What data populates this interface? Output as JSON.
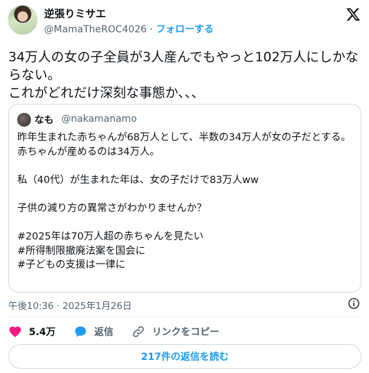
{
  "author": {
    "name": "逆張りミサエ",
    "handle": "@MamaTheROC4026",
    "separator": "·",
    "follow_label": "フォローする"
  },
  "tweet": {
    "text": "34万人の女の子全員が3人産んでもやっと102万人にしかならない。\nこれがどれだけ深刻な事態か、、、"
  },
  "quote": {
    "name": "なも",
    "handle": "@nakamanamo",
    "text": "昨年生まれた赤ちゃんが68万人として、半数の34万人が女の子だとする。\n赤ちゃんが産めるのは34万人。\n\n私（40代）が生まれた年は、女の子だけで83万人ww\n\n子供の減り方の異常さがわかりませんか？\n\n#2025年は70万人超の赤ちゃんを見たい\n#所得制限撤廃法案を国会に\n#子どもの支援は一律に"
  },
  "timestamp": "午後10:36 · 2025年1月26日",
  "actions": {
    "like_count": "5.4万",
    "reply_label": "返信",
    "copy_link_label": "リンクをコピー"
  },
  "read_replies_label": "217件の返信を読む",
  "colors": {
    "accent": "#1d9bf0",
    "like": "#f91880",
    "text": "#0f1419",
    "secondary": "#536471"
  },
  "icons": [
    "x-logo-icon",
    "info-icon",
    "heart-icon",
    "reply-bubble-icon",
    "link-icon"
  ]
}
